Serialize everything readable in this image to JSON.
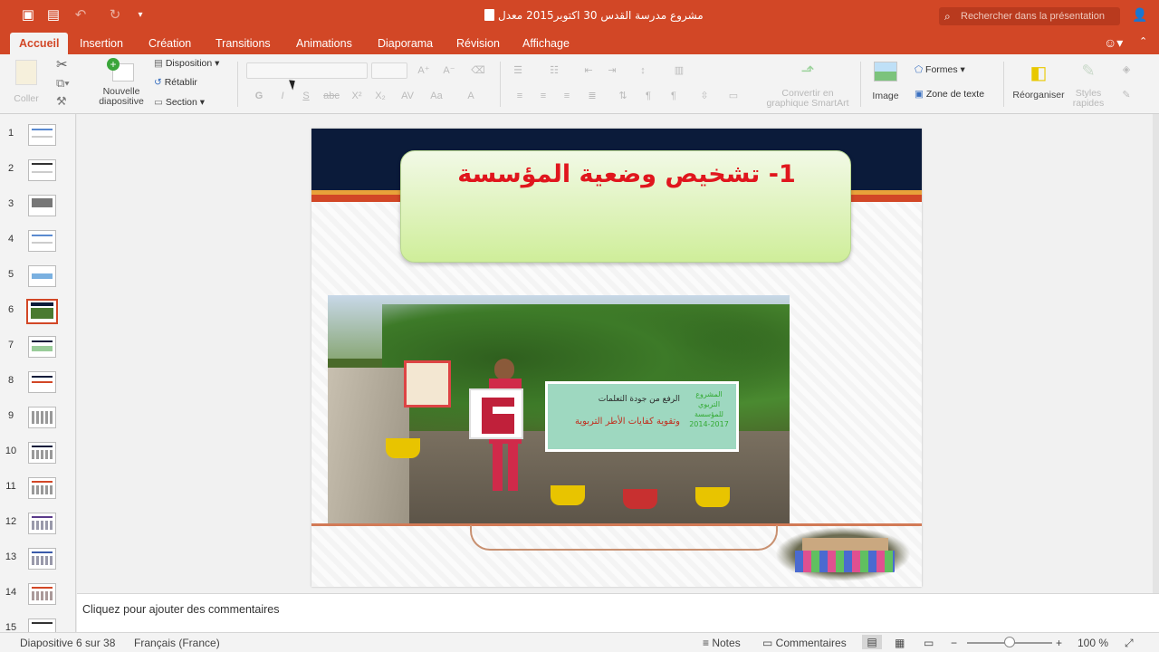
{
  "titlebar": {
    "doc_title": "مشروع مدرسة القدس 30 اكتوبر2015 معدل",
    "search_placeholder": "Rechercher dans la présentation",
    "icons": [
      "sidebar-icon",
      "save-icon",
      "undo-icon",
      "redo-icon",
      "customize-icon",
      "share-icon"
    ]
  },
  "tabs": [
    "Accueil",
    "Insertion",
    "Création",
    "Transitions",
    "Animations",
    "Diaporama",
    "Révision",
    "Affichage"
  ],
  "ribbon": {
    "paste_label": "Coller",
    "new_slide_label_1": "Nouvelle",
    "new_slide_label_2": "diapositive",
    "layout_label": "Disposition",
    "reset_label": "Rétablir",
    "section_label": "Section",
    "smartart_label_1": "Convertir en",
    "smartart_label_2": "graphique SmartArt",
    "image_label": "Image",
    "shapes_label": "Formes",
    "textbox_label": "Zone de texte",
    "arrange_label": "Réorganiser",
    "quick_styles_label_1": "Styles",
    "quick_styles_label_2": "rapides"
  },
  "thumbnails": [
    "1",
    "2",
    "3",
    "4",
    "5",
    "6",
    "7",
    "8",
    "9",
    "10",
    "11",
    "12",
    "13",
    "14",
    "15"
  ],
  "selected_slide": "6",
  "slide": {
    "title": "1- تشخيص وضعية المؤسسة",
    "sign_line1": "الرفع من جودة التعلمات",
    "sign_line2": "وتقوية كفايات الأطر التربوية",
    "sign_side": "المشروع التربوي للمؤسسة 2017-2014"
  },
  "notes_placeholder": "Cliquez pour ajouter des commentaires",
  "status": {
    "slide_counter": "Diapositive 6 sur 38",
    "language": "Français (France)",
    "notes_label": "Notes",
    "comments_label": "Commentaires",
    "zoom": "100 %"
  },
  "colors": {
    "accent": "#d24726",
    "title_red": "#e0161d"
  }
}
